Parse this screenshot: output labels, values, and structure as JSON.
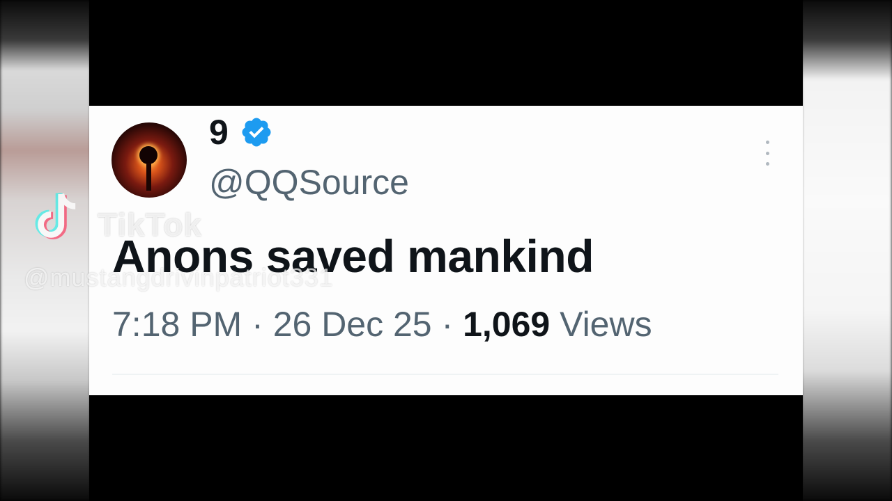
{
  "tweet": {
    "display_name": "9",
    "verified": true,
    "handle": "@QQSource",
    "text": "Anons saved mankind",
    "time": "7:18 PM",
    "separator_1": "·",
    "date": "26 Dec 25",
    "separator_2": "·",
    "views_count": "1,069",
    "views_label": "Views"
  },
  "watermark": {
    "brand": "TikTok",
    "username": "@mustangdrivinpatriot331"
  },
  "colors": {
    "verified_badge": "#1d9bf0",
    "primary_text": "#0f1419",
    "secondary_text": "#536471"
  }
}
